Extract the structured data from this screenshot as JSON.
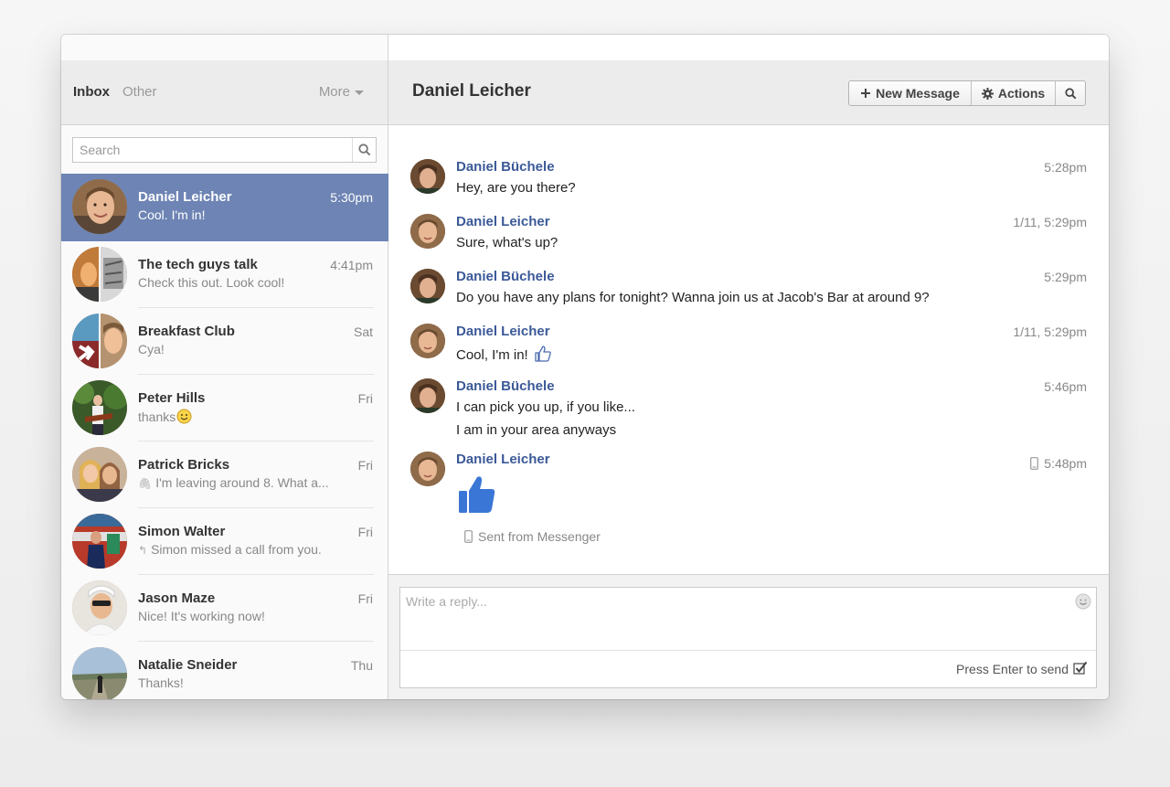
{
  "sidebar": {
    "tabs": [
      {
        "label": "Inbox"
      },
      {
        "label": "Other"
      }
    ],
    "more_label": "More",
    "search": {
      "placeholder": "Search"
    },
    "threads": [
      {
        "name": "Daniel Leicher",
        "time": "5:30pm",
        "snippet": "Cool. I'm in!",
        "active": true,
        "snippet_icon": ""
      },
      {
        "name": "The tech guys talk",
        "time": "4:41pm",
        "snippet": "Check this out. Look cool!",
        "snippet_icon": ""
      },
      {
        "name": "Breakfast Club",
        "time": "Sat",
        "snippet": "Cya!",
        "snippet_icon": ""
      },
      {
        "name": "Peter Hills",
        "time": "Fri",
        "snippet": "thanks",
        "snippet_icon": "smiley-emoji-icon"
      },
      {
        "name": "Patrick Bricks",
        "time": "Fri",
        "snippet": "I'm leaving around 8. What a...",
        "snippet_icon": "paperclip-icon"
      },
      {
        "name": "Simon Walter",
        "time": "Fri",
        "snippet": "Simon missed a call from you.",
        "snippet_icon": "reply-arrow-icon"
      },
      {
        "name": "Jason Maze",
        "time": "Fri",
        "snippet": "Nice! It's working now!",
        "snippet_icon": ""
      },
      {
        "name": "Natalie Sneider",
        "time": "Thu",
        "snippet": "Thanks!",
        "snippet_icon": ""
      }
    ]
  },
  "conversation": {
    "title": "Daniel Leicher",
    "buttons": {
      "new_message": "New Message",
      "actions": "Actions"
    },
    "messages": [
      {
        "sender": "Daniel Büchele",
        "time": "5:28pm",
        "lines": [
          "Hey, are you there?"
        ]
      },
      {
        "sender": "Daniel Leicher",
        "time": "1/11, 5:29pm",
        "lines": [
          "Sure, what's up?"
        ]
      },
      {
        "sender": "Daniel Büchele",
        "time": "5:29pm",
        "lines": [
          "Do you have any plans for tonight? Wanna join us at Jacob's Bar at around 9?"
        ]
      },
      {
        "sender": "Daniel Leicher",
        "time": "1/11, 5:29pm",
        "lines": [
          "Cool, I'm in!"
        ],
        "inline_icon": "thumbs-up-outline-icon"
      },
      {
        "sender": "Daniel Büchele",
        "time": "5:46pm",
        "lines": [
          "I can pick you up, if you like...",
          "I am in your area anyways"
        ]
      },
      {
        "sender": "Daniel Leicher",
        "time": "5:48pm",
        "time_icon": "mobile-phone-icon",
        "sticker": "thumbs-up-sticker-icon",
        "footer": "Sent from Messenger",
        "footer_icon": "mobile-phone-icon"
      }
    ]
  },
  "composer": {
    "placeholder": "Write a reply...",
    "press_enter_label": "Press Enter to send",
    "press_enter_checked": true
  },
  "colors": {
    "accent": "#3b5998",
    "selected_thread": "#6d84b4",
    "sticker": "#3a76d6"
  },
  "icons": [
    "window-close-icon",
    "window-minimize-icon",
    "window-zoom-icon",
    "chevron-down-icon",
    "search-icon",
    "plus-icon",
    "gear-icon",
    "smiley-icon",
    "checkbox-checked-icon"
  ]
}
